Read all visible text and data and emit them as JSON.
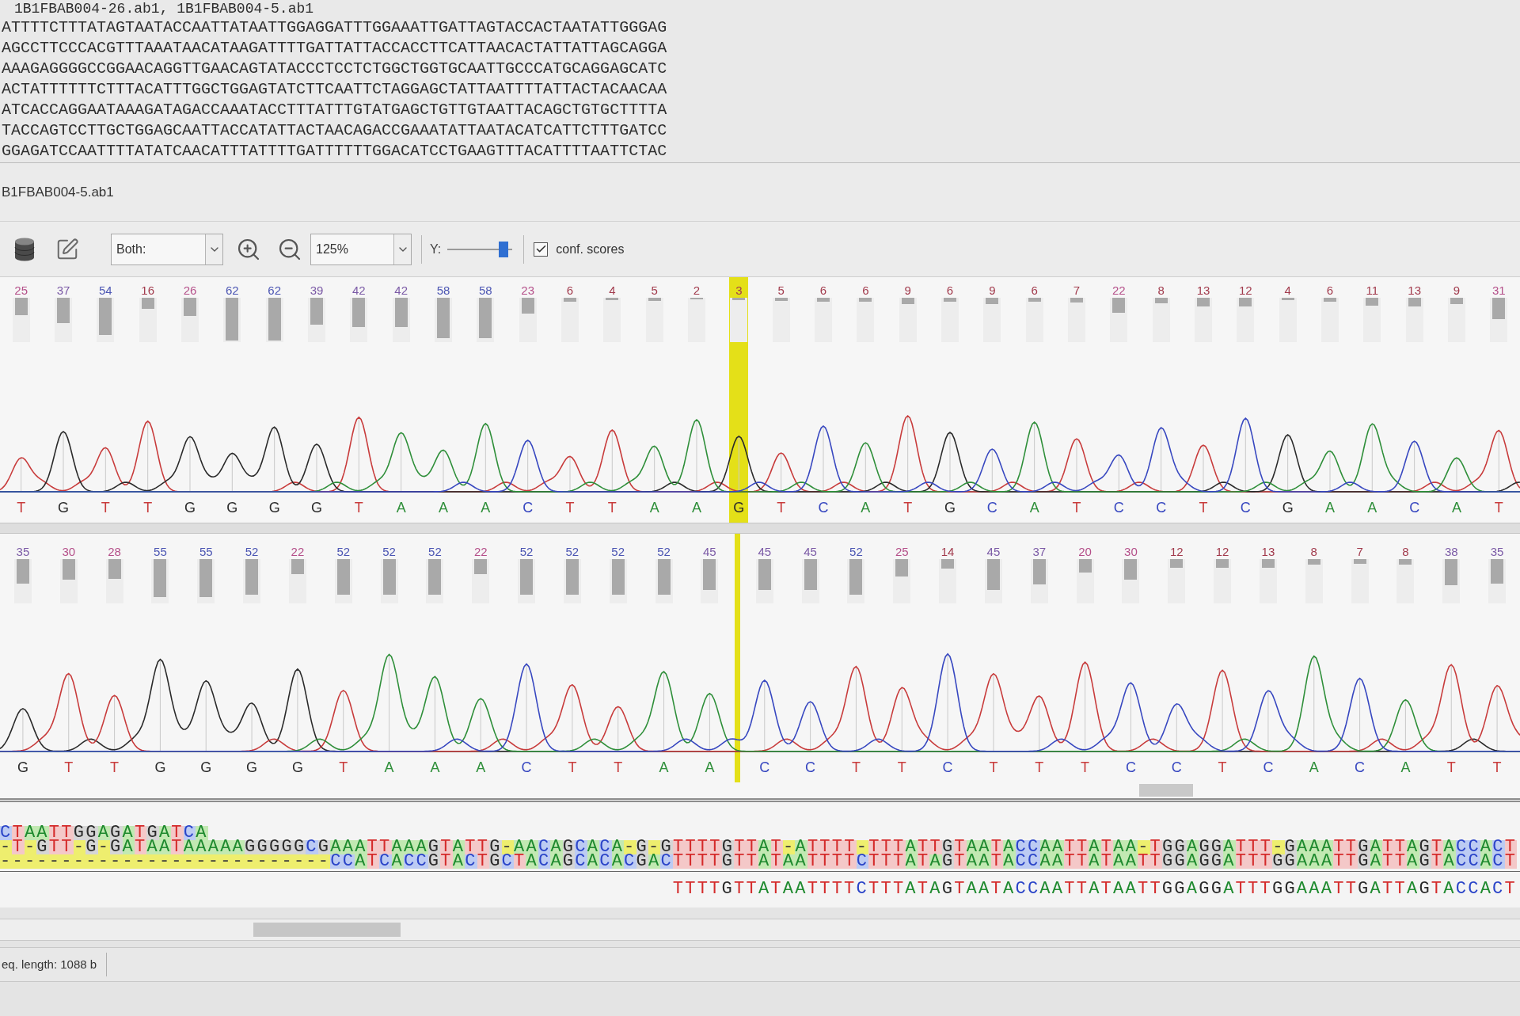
{
  "sequence_view": {
    "header": "1B1FBAB004-26.ab1, 1B1FBAB004-5.ab1",
    "lines": [
      "ATTTTCTTTATAGTAATACCAATTATAATTGGAGGATTTGGAAATTGATTAGTACCACTAATATTGGGAG",
      "AGCCTTCCCACGTTTAAATAACATAAGATTTTGATTATTACCACCTTCATTAACACTATTATTAGCAGGA",
      "AAAGAGGGGCCGGAACAGGTTGAACAGTATACCCTCCTCTGGCTGGTGCAATTGCCCATGCAGGAGCATC",
      "ACTATTTTTTCTTTACATTTGGCTGGAGTATCTTCAATTCTAGGAGCTATTAATTTTATTACTACAACAA",
      "ATCACCAGGAATAAAGATAGACCAAATACCTTTATTTGTATGAGCTGTTGTAATTACAGCTGTGCTTTTA",
      "TACCAGTCCTTGCTGGAGCAATTACCATATTACTAACAGACCGAAATATTAATACATCATTCTTTGATCC",
      "GGAGATCCAATTTTATATCAACATTTATTTTGATTTTTTGGACATCCTGAAGTTTACATTTTAATTCTAC"
    ]
  },
  "trace_panel": {
    "title": "B1FBAB004-5.ab1"
  },
  "toolbar": {
    "view_select": {
      "value": "Both:"
    },
    "zoom_select": {
      "value": "125%"
    },
    "y_scale": {
      "label": "Y:",
      "level": 0.92
    },
    "conf_scores": {
      "label": "conf. scores",
      "checked": true
    }
  },
  "traces": [
    {
      "calls": [
        {
          "kind": "base",
          "base": "T",
          "score": "25",
          "level": 0.39,
          "color": "#c83c3c",
          "selected": false
        },
        {
          "kind": "base",
          "base": "G",
          "score": "37",
          "level": 0.58,
          "color": "#2b2b2b",
          "selected": false
        },
        {
          "kind": "base",
          "base": "T",
          "score": "54",
          "level": 0.84,
          "color": "#c83c3c",
          "selected": false
        },
        {
          "kind": "base",
          "base": "T",
          "score": "16",
          "level": 0.25,
          "color": "#c83c3c",
          "selected": false
        },
        {
          "kind": "base",
          "base": "G",
          "score": "26",
          "level": 0.41,
          "color": "#2b2b2b",
          "selected": false
        },
        {
          "kind": "base",
          "base": "G",
          "score": "62",
          "level": 0.97,
          "color": "#2b2b2b",
          "selected": false
        },
        {
          "kind": "base",
          "base": "G",
          "score": "62",
          "level": 0.97,
          "color": "#2b2b2b",
          "selected": false
        },
        {
          "kind": "base",
          "base": "G",
          "score": "39",
          "level": 0.61,
          "color": "#2b2b2b",
          "selected": false
        },
        {
          "kind": "base",
          "base": "T",
          "score": "42",
          "level": 0.66,
          "color": "#c83c3c",
          "selected": false
        },
        {
          "kind": "base",
          "base": "A",
          "score": "42",
          "level": 0.66,
          "color": "#2f8f3a",
          "selected": false
        },
        {
          "kind": "base",
          "base": "A",
          "score": "58",
          "level": 0.91,
          "color": "#2f8f3a",
          "selected": false
        },
        {
          "kind": "base",
          "base": "A",
          "score": "58",
          "level": 0.91,
          "color": "#2f8f3a",
          "selected": false
        },
        {
          "kind": "base",
          "base": "C",
          "score": "23",
          "level": 0.36,
          "color": "#3848c0",
          "selected": false
        },
        {
          "kind": "base",
          "base": "T",
          "score": "6",
          "level": 0.09,
          "color": "#c83c3c",
          "selected": false
        },
        {
          "kind": "base",
          "base": "T",
          "score": "4",
          "level": 0.06,
          "color": "#c83c3c",
          "selected": false
        },
        {
          "kind": "base",
          "base": "A",
          "score": "5",
          "level": 0.08,
          "color": "#2f8f3a",
          "selected": false
        },
        {
          "kind": "base",
          "base": "A",
          "score": "2",
          "level": 0.03,
          "color": "#2f8f3a",
          "selected": false
        },
        {
          "kind": "base",
          "base": "G",
          "score": "3",
          "level": 0.05,
          "color": "#2b2b2b",
          "selected": true
        },
        {
          "kind": "base",
          "base": "T",
          "score": "5",
          "level": 0.08,
          "color": "#c83c3c",
          "selected": false
        },
        {
          "kind": "base",
          "base": "C",
          "score": "6",
          "level": 0.09,
          "color": "#3848c0",
          "selected": false
        },
        {
          "kind": "base",
          "base": "A",
          "score": "6",
          "level": 0.09,
          "color": "#2f8f3a",
          "selected": false
        },
        {
          "kind": "base",
          "base": "T",
          "score": "9",
          "level": 0.14,
          "color": "#c83c3c",
          "selected": false
        },
        {
          "kind": "base",
          "base": "G",
          "score": "6",
          "level": 0.09,
          "color": "#2b2b2b",
          "selected": false
        },
        {
          "kind": "base",
          "base": "C",
          "score": "9",
          "level": 0.14,
          "color": "#3848c0",
          "selected": false
        },
        {
          "kind": "base",
          "base": "A",
          "score": "6",
          "level": 0.09,
          "color": "#2f8f3a",
          "selected": false
        },
        {
          "kind": "base",
          "base": "T",
          "score": "7",
          "level": 0.11,
          "color": "#c83c3c",
          "selected": false
        },
        {
          "kind": "base",
          "base": "C",
          "score": "22",
          "level": 0.34,
          "color": "#3848c0",
          "selected": false
        },
        {
          "kind": "base",
          "base": "C",
          "score": "8",
          "level": 0.13,
          "color": "#3848c0",
          "selected": false
        },
        {
          "kind": "base",
          "base": "T",
          "score": "13",
          "level": 0.2,
          "color": "#c83c3c",
          "selected": false
        },
        {
          "kind": "base",
          "base": "C",
          "score": "12",
          "level": 0.19,
          "color": "#3848c0",
          "selected": false
        },
        {
          "kind": "base",
          "base": "G",
          "score": "4",
          "level": 0.06,
          "color": "#2b2b2b",
          "selected": false
        },
        {
          "kind": "base",
          "base": "A",
          "score": "6",
          "level": 0.09,
          "color": "#2f8f3a",
          "selected": false
        },
        {
          "kind": "base",
          "base": "A",
          "score": "11",
          "level": 0.17,
          "color": "#2f8f3a",
          "selected": false
        },
        {
          "kind": "base",
          "base": "C",
          "score": "13",
          "level": 0.2,
          "color": "#3848c0",
          "selected": false
        },
        {
          "kind": "base",
          "base": "A",
          "score": "9",
          "level": 0.14,
          "color": "#2f8f3a",
          "selected": false
        },
        {
          "kind": "base",
          "base": "T",
          "score": "31",
          "level": 0.48,
          "color": "#c83c3c",
          "selected": false
        }
      ]
    },
    {
      "calls": [
        {
          "kind": "base",
          "base": "G",
          "score": "35",
          "level": 0.55,
          "color": "#2b2b2b",
          "selected": false
        },
        {
          "kind": "base",
          "base": "T",
          "score": "30",
          "level": 0.47,
          "color": "#c83c3c",
          "selected": false
        },
        {
          "kind": "base",
          "base": "T",
          "score": "28",
          "level": 0.44,
          "color": "#c83c3c",
          "selected": false
        },
        {
          "kind": "base",
          "base": "G",
          "score": "55",
          "level": 0.86,
          "color": "#2b2b2b",
          "selected": false
        },
        {
          "kind": "base",
          "base": "G",
          "score": "55",
          "level": 0.86,
          "color": "#2b2b2b",
          "selected": false
        },
        {
          "kind": "base",
          "base": "G",
          "score": "52",
          "level": 0.81,
          "color": "#2b2b2b",
          "selected": false
        },
        {
          "kind": "base",
          "base": "G",
          "score": "22",
          "level": 0.34,
          "color": "#2b2b2b",
          "selected": false
        },
        {
          "kind": "base",
          "base": "T",
          "score": "52",
          "level": 0.81,
          "color": "#c83c3c",
          "selected": false
        },
        {
          "kind": "base",
          "base": "A",
          "score": "52",
          "level": 0.81,
          "color": "#2f8f3a",
          "selected": false
        },
        {
          "kind": "base",
          "base": "A",
          "score": "52",
          "level": 0.81,
          "color": "#2f8f3a",
          "selected": false
        },
        {
          "kind": "base",
          "base": "A",
          "score": "22",
          "level": 0.34,
          "color": "#2f8f3a",
          "selected": false
        },
        {
          "kind": "base",
          "base": "C",
          "score": "52",
          "level": 0.81,
          "color": "#3848c0",
          "selected": false
        },
        {
          "kind": "base",
          "base": "T",
          "score": "52",
          "level": 0.81,
          "color": "#c83c3c",
          "selected": false
        },
        {
          "kind": "base",
          "base": "T",
          "score": "52",
          "level": 0.81,
          "color": "#c83c3c",
          "selected": false
        },
        {
          "kind": "base",
          "base": "A",
          "score": "52",
          "level": 0.81,
          "color": "#2f8f3a",
          "selected": false
        },
        {
          "kind": "base",
          "base": "A",
          "score": "45",
          "level": 0.7,
          "color": "#2f8f3a",
          "selected": false
        },
        {
          "kind": "gap",
          "selected": true
        },
        {
          "kind": "base",
          "base": "C",
          "score": "45",
          "level": 0.7,
          "color": "#3848c0",
          "selected": false
        },
        {
          "kind": "base",
          "base": "C",
          "score": "45",
          "level": 0.7,
          "color": "#3848c0",
          "selected": false
        },
        {
          "kind": "base",
          "base": "T",
          "score": "52",
          "level": 0.81,
          "color": "#c83c3c",
          "selected": false
        },
        {
          "kind": "base",
          "base": "T",
          "score": "25",
          "level": 0.39,
          "color": "#c83c3c",
          "selected": false
        },
        {
          "kind": "base",
          "base": "C",
          "score": "14",
          "level": 0.22,
          "color": "#3848c0",
          "selected": false
        },
        {
          "kind": "base",
          "base": "T",
          "score": "45",
          "level": 0.7,
          "color": "#c83c3c",
          "selected": false
        },
        {
          "kind": "base",
          "base": "T",
          "score": "37",
          "level": 0.58,
          "color": "#c83c3c",
          "selected": false
        },
        {
          "kind": "base",
          "base": "T",
          "score": "20",
          "level": 0.31,
          "color": "#c83c3c",
          "selected": false
        },
        {
          "kind": "base",
          "base": "C",
          "score": "30",
          "level": 0.47,
          "color": "#3848c0",
          "selected": false
        },
        {
          "kind": "base",
          "base": "C",
          "score": "12",
          "level": 0.19,
          "color": "#3848c0",
          "selected": false
        },
        {
          "kind": "base",
          "base": "T",
          "score": "12",
          "level": 0.19,
          "color": "#c83c3c",
          "selected": false
        },
        {
          "kind": "base",
          "base": "C",
          "score": "13",
          "level": 0.2,
          "color": "#3848c0",
          "selected": false
        },
        {
          "kind": "base",
          "base": "A",
          "score": "8",
          "level": 0.13,
          "color": "#2f8f3a",
          "selected": false
        },
        {
          "kind": "base",
          "base": "C",
          "score": "7",
          "level": 0.11,
          "color": "#3848c0",
          "selected": false
        },
        {
          "kind": "base",
          "base": "A",
          "score": "8",
          "level": 0.13,
          "color": "#2f8f3a",
          "selected": false
        },
        {
          "kind": "base",
          "base": "T",
          "score": "38",
          "level": 0.59,
          "color": "#c83c3c",
          "selected": false
        },
        {
          "kind": "base",
          "base": "T",
          "score": "35",
          "level": 0.55,
          "color": "#c83c3c",
          "selected": false
        }
      ]
    }
  ],
  "alignment": {
    "rows": [
      {
        "kind": "shaded",
        "text": "CTAATTGGAGATGATCA"
      },
      {
        "kind": "shaded",
        "text": "-T-GTT-G-GATAATAAAAAGGGGGCGAAATTAAAGTATTG-AACAGCACA-G-GTTTTGTTAT-ATTTT-TTTATTGTAATACCAATTATAA-TGGAGGATTT-GAAATTGATTAGTACCACT"
      },
      {
        "kind": "shaded",
        "text": "---------------------------CCATCACCGTACTGCTACAGCACACGACTTTTGTTATAATTTTCTTTATAGTAATACCAATTATAATTGGAGGATTTGGAAATTGATTAGTACCACT"
      },
      {
        "kind": "plain",
        "text": "TTTTGTTATAATTTTCTTTATAGTAATACCAATTATAATTGGAGGATTTGGAAATTGATTAGTACCACT"
      }
    ]
  },
  "status_bar": {
    "text": "eq. length: 1088 b"
  }
}
